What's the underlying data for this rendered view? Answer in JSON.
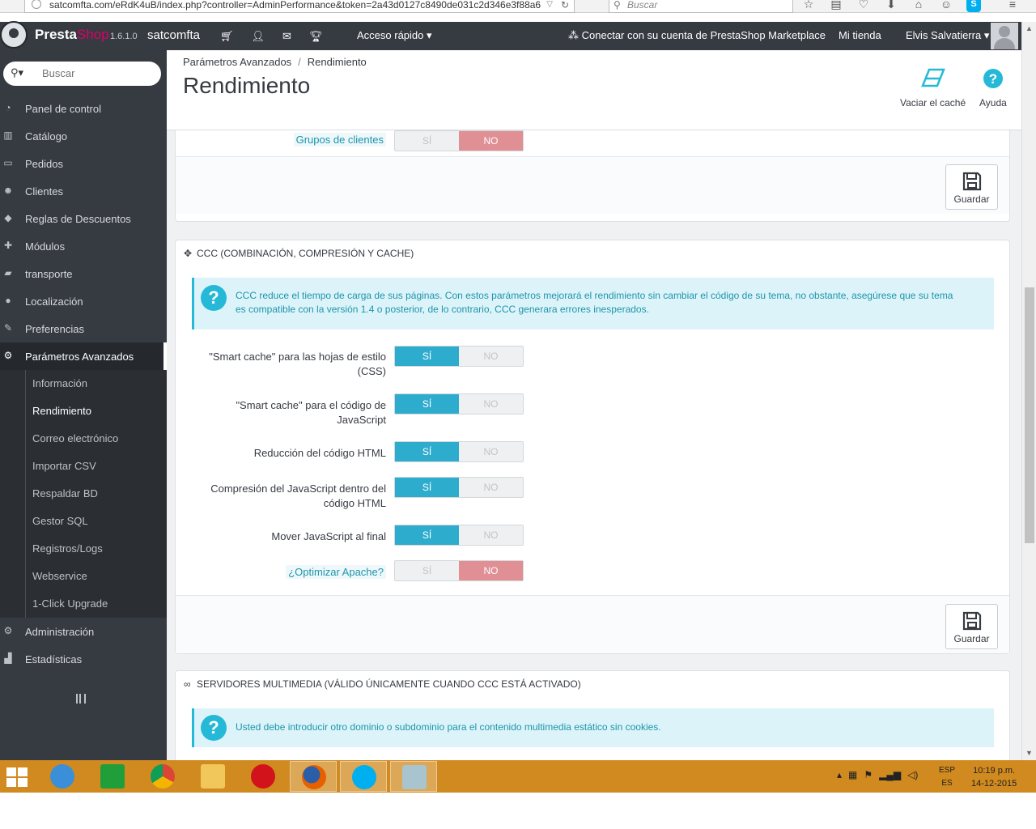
{
  "browser": {
    "url": "satcomfta.com/eRdK4uB/index.php?controller=AdminPerformance&token=2a43d0127c8490de031c2d346e3f88a6",
    "search_placeholder": "Buscar"
  },
  "header": {
    "brand_presta": "Presta",
    "brand_shop": "Shop",
    "version": "1.6.1.0",
    "shop_name": "satcomfta",
    "quick_access": "Acceso rápido",
    "marketplace": "Conectar con su cuenta de PrestaShop Marketplace",
    "my_store": "Mi tienda",
    "user_name": "Elvis Salvatierra"
  },
  "sidebar": {
    "search_placeholder": "Buscar",
    "items": [
      {
        "label": "Panel de control",
        "icon": "dashboard-icon"
      },
      {
        "label": "Catálogo",
        "icon": "book-icon"
      },
      {
        "label": "Pedidos",
        "icon": "credit-card-icon"
      },
      {
        "label": "Clientes",
        "icon": "users-icon"
      },
      {
        "label": "Reglas de Descuentos",
        "icon": "tags-icon"
      },
      {
        "label": "Módulos",
        "icon": "puzzle-icon"
      },
      {
        "label": "transporte",
        "icon": "truck-icon"
      },
      {
        "label": "Localización",
        "icon": "globe-icon"
      },
      {
        "label": "Preferencias",
        "icon": "wrench-icon"
      },
      {
        "label": "Parámetros Avanzados",
        "icon": "cogs-icon"
      },
      {
        "label": "Administración",
        "icon": "cog-icon"
      },
      {
        "label": "Estadísticas",
        "icon": "bar-chart-icon"
      }
    ],
    "subitems": [
      "Información",
      "Rendimiento",
      "Correo electrónico",
      "Importar CSV",
      "Respaldar BD",
      "Gestor SQL",
      "Registros/Logs",
      "Webservice",
      "1-Click Upgrade"
    ]
  },
  "page": {
    "breadcrumb_parent": "Parámetros Avanzados",
    "breadcrumb_current": "Rendimiento",
    "title": "Rendimiento",
    "toolbar_clear_cache": "Vaciar el caché",
    "toolbar_help": "Ayuda"
  },
  "panel_top": {
    "row_label": "Grupos de clientes",
    "yes": "SÍ",
    "no": "NO",
    "save": "Guardar"
  },
  "panel_ccc": {
    "title": "CCC (COMBINACIÓN, COMPRESIÓN Y CACHE)",
    "info_line1": "CCC reduce el tiempo de carga de sus páginas. Con estos parámetros mejorará el rendimiento sin cambiar el código de su tema, no obstante, asegúrese que su tema",
    "info_line2": "es compatible con la versión 1.4 o posterior, de lo contrario, CCC generara errores inesperados.",
    "yes": "SÍ",
    "no": "NO",
    "rows": [
      {
        "line1": "\"Smart cache\" para las hojas de estilo",
        "line2": "(CSS)",
        "value": "SÍ"
      },
      {
        "line1": "\"Smart cache\" para el código de",
        "line2": "JavaScript",
        "value": "SÍ"
      },
      {
        "line1": "Reducción del código HTML",
        "line2": "",
        "value": "SÍ"
      },
      {
        "line1": "Compresión del JavaScript dentro del",
        "line2": "código HTML",
        "value": "SÍ"
      },
      {
        "line1": "Mover JavaScript al final",
        "line2": "",
        "value": "SÍ"
      },
      {
        "line1": "¿Optimizar Apache?",
        "line2": "",
        "value": "NO"
      }
    ],
    "save": "Guardar"
  },
  "panel_media": {
    "title": "SERVIDORES MULTIMEDIA (VÁLIDO ÚNICAMENTE CUANDO CCC ESTÁ ACTIVADO)",
    "info": "Usted debe introducir otro dominio o subdominio para el contenido multimedia estático sin cookies."
  },
  "taskbar": {
    "lang_top": "ESP",
    "lang_bottom": "ES",
    "time": "10:19 p.m.",
    "date": "14-12-2015"
  },
  "colors": {
    "header_bg": "#363a41",
    "toggle_on": "#2eacce",
    "toggle_off": "#e08f95",
    "info_bg": "#dcf4f9",
    "taskbar": "#d08a1f"
  }
}
